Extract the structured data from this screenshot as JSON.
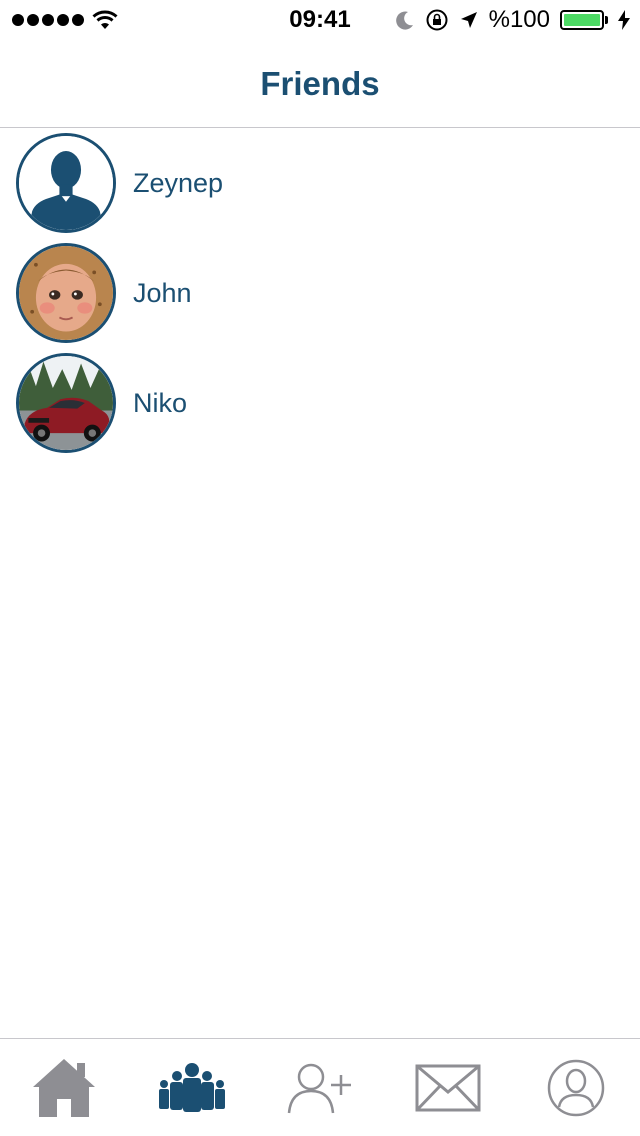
{
  "status_bar": {
    "time": "09:41",
    "battery": "%100",
    "battery_color": "#4cd964"
  },
  "nav": {
    "title": "Friends"
  },
  "colors": {
    "accent": "#1b4f72",
    "inactive": "#8e8e93"
  },
  "friends": [
    {
      "name": "Zeynep",
      "avatar": "default-silhouette-icon"
    },
    {
      "name": "John",
      "avatar": "baby-photo"
    },
    {
      "name": "Niko",
      "avatar": "red-car-photo"
    }
  ],
  "tabs": [
    {
      "icon": "home-icon",
      "active": false
    },
    {
      "icon": "friends-group-icon",
      "active": true
    },
    {
      "icon": "add-friend-icon",
      "active": false
    },
    {
      "icon": "mail-icon",
      "active": false
    },
    {
      "icon": "profile-icon",
      "active": false
    }
  ]
}
